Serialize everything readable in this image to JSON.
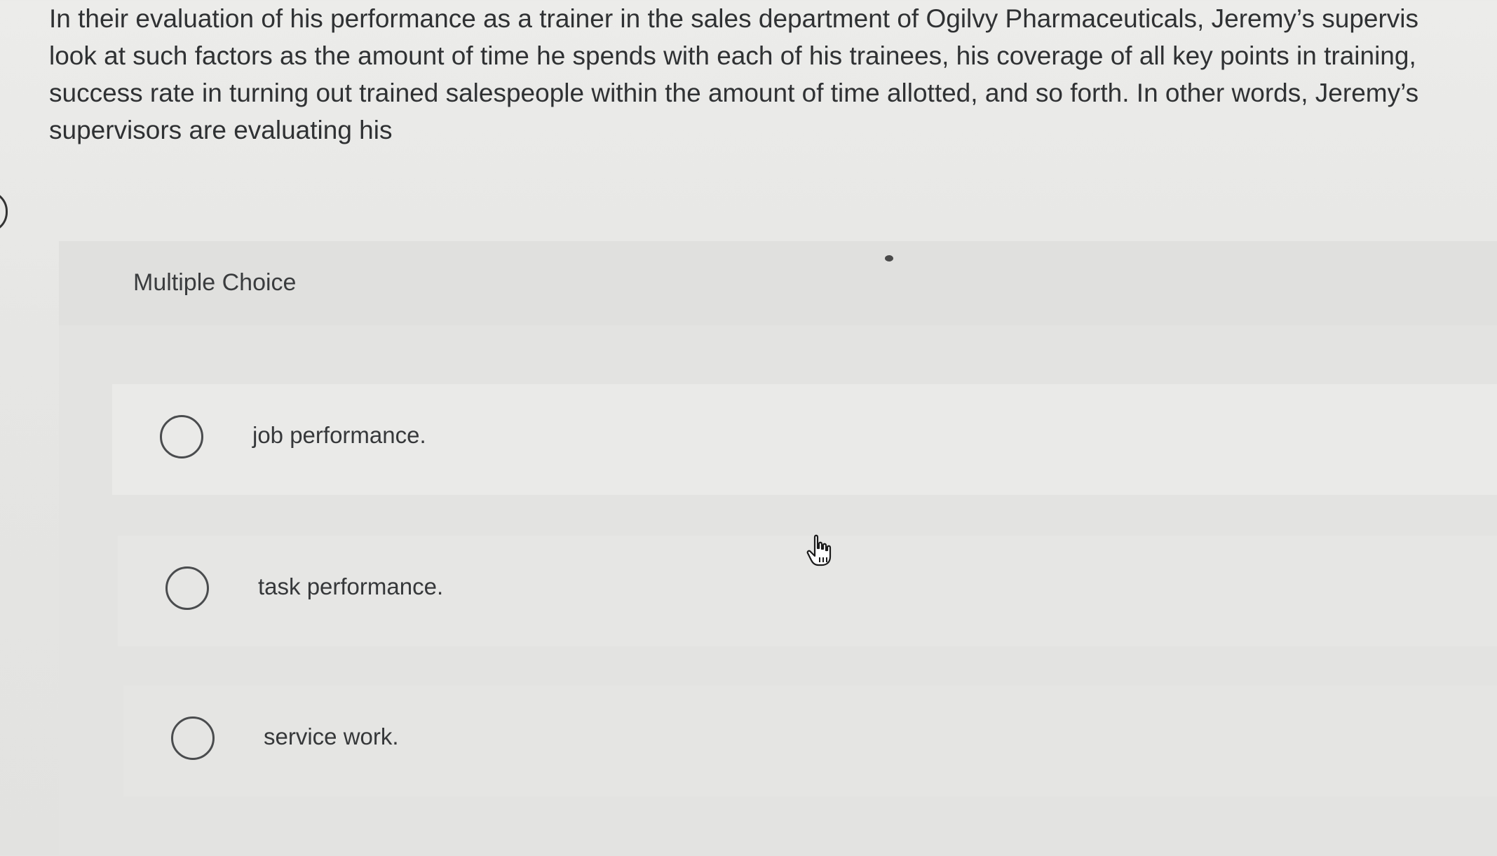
{
  "question": {
    "lines": [
      "In their evaluation of his performance as a trainer in the sales department of Ogilvy Pharmaceuticals, Jeremy’s supervis",
      "look at such factors as the amount of time he spends with each of his trainees, his coverage of all key points in training,",
      "success rate in turning out trained salespeople within the amount of time allotted, and so forth. In other words, Jeremy’s",
      "supervisors are evaluating his"
    ]
  },
  "multiple_choice": {
    "label": "Multiple Choice",
    "options": [
      {
        "label": "job performance.",
        "selected": false
      },
      {
        "label": "task performance.",
        "selected": false
      },
      {
        "label": "service work.",
        "selected": false
      }
    ]
  },
  "icons": {
    "radio": "radio-circle-icon",
    "cursor": "hand-pointer-icon"
  }
}
